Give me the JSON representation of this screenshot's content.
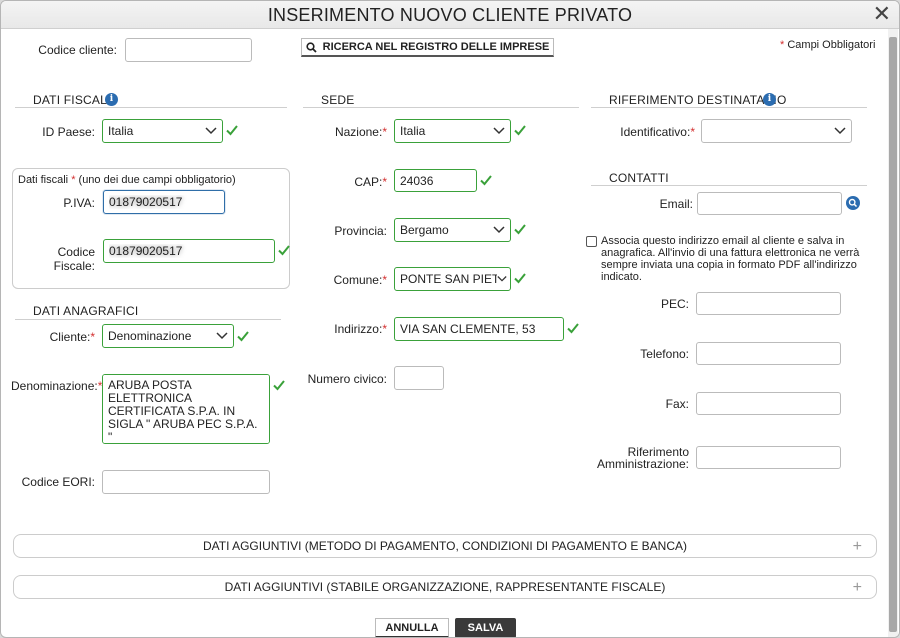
{
  "window": {
    "title": "INSERIMENTO NUOVO CLIENTE PRIVATO",
    "close_glyph": "✕"
  },
  "header": {
    "codice_cliente_label": "Codice cliente:",
    "codice_cliente_value": "",
    "search_button_label": "RICERCA NEL REGISTRO DELLE IMPRESE",
    "required_note": "Campi Obbligatori"
  },
  "dati_fiscali": {
    "title": "DATI FISCALI",
    "id_paese_label": "ID Paese:",
    "id_paese_value": "Italia",
    "box_title": "Dati fiscali",
    "box_note": "(uno dei due campi obbligatorio)",
    "piva_label": "P.IVA:",
    "piva_value": "01879020517",
    "codice_fiscale_label": "Codice Fiscale:",
    "codice_fiscale_value": "01879020517"
  },
  "dati_anagrafici": {
    "title": "DATI ANAGRAFICI",
    "cliente_label": "Cliente:",
    "cliente_value": "Denominazione",
    "denominazione_label": "Denominazione:",
    "denominazione_value": "ARUBA POSTA ELETTRONICA CERTIFICATA S.P.A. IN SIGLA \" ARUBA PEC S.P.A. \"",
    "codice_eori_label": "Codice EORI:",
    "codice_eori_value": ""
  },
  "sede": {
    "title": "SEDE",
    "nazione_label": "Nazione:",
    "nazione_value": "Italia",
    "cap_label": "CAP:",
    "cap_value": "24036",
    "provincia_label": "Provincia:",
    "provincia_value": "Bergamo",
    "comune_label": "Comune:",
    "comune_value": "PONTE SAN PIETRO",
    "indirizzo_label": "Indirizzo:",
    "indirizzo_value": "VIA SAN CLEMENTE, 53",
    "numero_civico_label": "Numero civico:",
    "numero_civico_value": ""
  },
  "riferimento": {
    "title": "RIFERIMENTO DESTINATARIO",
    "identificativo_label": "Identificativo:",
    "identificativo_value": ""
  },
  "contatti": {
    "title": "CONTATTI",
    "email_label": "Email:",
    "email_value": "",
    "associa_text": "Associa questo indirizzo email al cliente e salva in anagrafica. All'invio di una fattura elettronica ne verrà sempre inviata una copia in formato PDF all'indirizzo indicato.",
    "pec_label": "PEC:",
    "telefono_label": "Telefono:",
    "fax_label": "Fax:",
    "rif_amm_label_1": "Riferimento",
    "rif_amm_label_2": "Amministrazione:"
  },
  "accordions": [
    {
      "label": "DATI AGGIUNTIVI (METODO DI PAGAMENTO, CONDIZIONI DI PAGAMENTO E BANCA)"
    },
    {
      "label": "DATI AGGIUNTIVI (STABILE ORGANIZZAZIONE, RAPPRESENTANTE FISCALE)"
    }
  ],
  "footer": {
    "annulla_label": "ANNULLA",
    "salva_label": "SALVA"
  },
  "colors": {
    "ok_green": "#3aa13a",
    "required_red": "#d32f2f",
    "info_blue": "#2b6cb0",
    "save_bg": "#3a3a3a"
  }
}
